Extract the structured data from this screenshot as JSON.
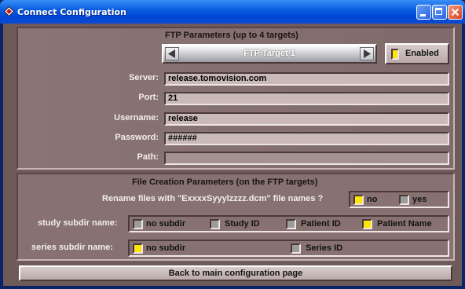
{
  "window": {
    "title": "Connect Configuration",
    "icon": "diamond-app-icon"
  },
  "ftp": {
    "header": "FTP Parameters (up to 4 targets)",
    "target_label": "FTP Target 1",
    "enabled_label": "Enabled",
    "enabled": true,
    "fields": [
      {
        "label": "Server:",
        "value": "release.tomovision.com"
      },
      {
        "label": "Port:",
        "value": "21"
      },
      {
        "label": "Username:",
        "value": "release"
      },
      {
        "label": "Password:",
        "value": "######"
      },
      {
        "label": "Path:",
        "value": ""
      }
    ]
  },
  "file": {
    "header": "File Creation Parameters (on the FTP targets)",
    "rename_label": "Rename files with \"ExxxxSyyylzzzz.dcm\" file names ?",
    "rename_options": [
      {
        "label": "no",
        "checked": true
      },
      {
        "label": "yes",
        "checked": false
      }
    ],
    "study_label": "study subdir name:",
    "study_options": [
      {
        "label": "no subdir",
        "checked": false
      },
      {
        "label": "Study ID",
        "checked": false
      },
      {
        "label": "Patient ID",
        "checked": false
      },
      {
        "label": "Patient Name",
        "checked": true
      }
    ],
    "series_label": "series subdir name:",
    "series_options": [
      {
        "label": "no subdir",
        "checked": true
      },
      {
        "label": "Series ID",
        "checked": false
      }
    ]
  },
  "footer": {
    "back_label": "Back to main configuration page"
  },
  "colors": {
    "title_bar": "#0046d5",
    "panel": "#877271",
    "checked": "#ffe600"
  }
}
